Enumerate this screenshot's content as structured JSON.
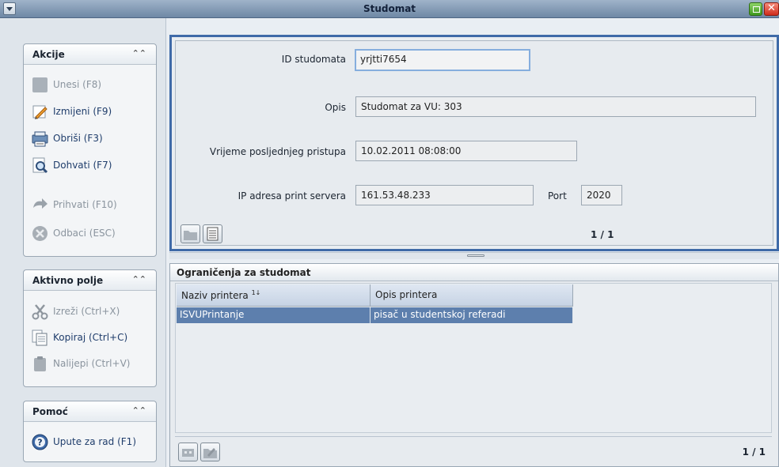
{
  "window": {
    "title": "Studomat"
  },
  "sidebar": {
    "akcije": {
      "title": "Akcije",
      "items": [
        {
          "label": "Unesi (F8)",
          "icon": "new-record-icon",
          "enabled": false
        },
        {
          "label": "Izmijeni (F9)",
          "icon": "pencil-icon",
          "enabled": true
        },
        {
          "label": "Obriši (F3)",
          "icon": "delete-printer-icon",
          "enabled": true
        },
        {
          "label": "Dohvati (F7)",
          "icon": "magnifier-icon",
          "enabled": true
        },
        {
          "label": "Prihvati (F10)",
          "icon": "accept-arrow-icon",
          "enabled": false
        },
        {
          "label": "Odbaci (ESC)",
          "icon": "cancel-icon",
          "enabled": false
        }
      ]
    },
    "aktivno_polje": {
      "title": "Aktivno polje",
      "items": [
        {
          "label": "Izreži (Ctrl+X)",
          "icon": "scissors-icon",
          "enabled": false
        },
        {
          "label": "Kopiraj (Ctrl+C)",
          "icon": "copy-icon",
          "enabled": true
        },
        {
          "label": "Nalijepi (Ctrl+V)",
          "icon": "paste-icon",
          "enabled": false
        }
      ]
    },
    "pomoc": {
      "title": "Pomoć",
      "items": [
        {
          "label": "Upute za rad (F1)",
          "icon": "help-icon",
          "enabled": true
        }
      ]
    }
  },
  "form": {
    "id_label": "ID studomata",
    "id_value": "yrjtti7654",
    "opis_label": "Opis",
    "opis_value": "Studomat za VU: 303",
    "vrijeme_label": "Vrijeme posljednjeg pristupa",
    "vrijeme_value": "10.02.2011 08:08:00",
    "ip_label": "IP adresa print servera",
    "ip_value": "161.53.48.233",
    "port_label": "Port",
    "port_value": "2020",
    "pager": "1 / 1"
  },
  "table": {
    "title": "Ograničenja za studomat",
    "columns": [
      "Naziv printera",
      "Opis printera"
    ],
    "sort_indicator": "1↓",
    "rows": [
      [
        "ISVUPrintanje",
        "pisač u studentskoj referadi"
      ]
    ],
    "pager": "1 / 1"
  },
  "colors": {
    "accent_border": "#3f6aa8",
    "selected_row": "#5d7fad",
    "link_text": "#1f3d6b"
  }
}
